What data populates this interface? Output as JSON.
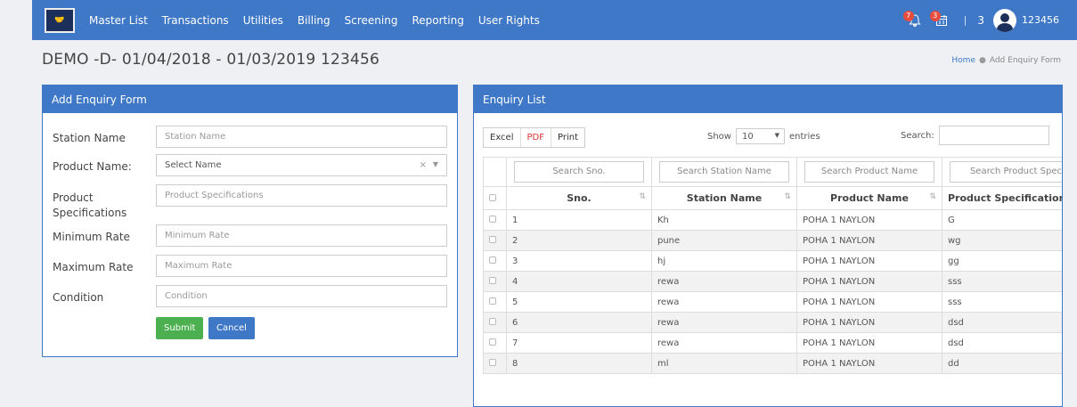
{
  "nav": {
    "logo_text": "",
    "menu": [
      "Master List",
      "Transactions",
      "Utilities",
      "Billing",
      "Screening",
      "Reporting",
      "User Rights"
    ],
    "notif_badge": "7",
    "calendar_badge": "3",
    "count": "3",
    "username": "123456"
  },
  "header": {
    "title": "DEMO -D- 01/04/2018 - 01/03/2019 123456",
    "breadcrumb_home": "Home",
    "breadcrumb_current": "Add Enquiry Form"
  },
  "form": {
    "heading": "Add Enquiry Form",
    "station_label": "Station Name",
    "station_placeholder": "Station Name",
    "product_label": "Product Name:",
    "product_value": "Select Name",
    "spec_label": "Product Specifications",
    "spec_placeholder": "Product Specifications",
    "min_label": "Minimum Rate",
    "min_placeholder": "Minimum Rate",
    "max_label": "Maximum Rate",
    "max_placeholder": "Maximum Rate",
    "cond_label": "Condition",
    "cond_placeholder": "Condition",
    "submit": "Submit",
    "cancel": "Cancel"
  },
  "list": {
    "heading": "Enquiry List",
    "excel": "Excel",
    "pdf": "PDF",
    "print": "Print",
    "show": "Show",
    "entries_value": "10",
    "entries": "entries",
    "search": "Search:",
    "col_search": [
      "Search Sno.",
      "Search Station Name",
      "Search Product Name",
      "Search Product Specifi"
    ],
    "columns": [
      "Sno.",
      "Station Name",
      "Product Name",
      "Product Specification"
    ],
    "rows": [
      [
        "1",
        "Kh",
        "POHA 1 NAYLON",
        "G"
      ],
      [
        "2",
        "pune",
        "POHA 1 NAYLON",
        "wg"
      ],
      [
        "3",
        "hj",
        "POHA 1 NAYLON",
        "gg"
      ],
      [
        "4",
        "rewa",
        "POHA 1 NAYLON",
        "sss"
      ],
      [
        "5",
        "rewa",
        "POHA 1 NAYLON",
        "sss"
      ],
      [
        "6",
        "rewa",
        "POHA 1 NAYLON",
        "dsd"
      ],
      [
        "7",
        "rewa",
        "POHA 1 NAYLON",
        "dsd"
      ],
      [
        "8",
        "ml",
        "POHA 1 NAYLON",
        "dd"
      ]
    ]
  }
}
